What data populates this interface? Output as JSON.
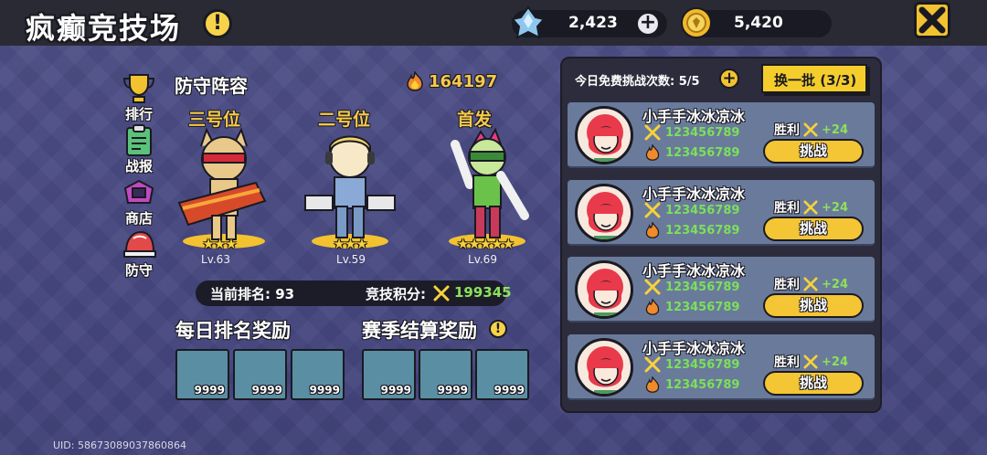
{
  "header": {
    "title": "疯癫竞技场",
    "gems": "2,423",
    "coins": "5,420"
  },
  "nav": [
    {
      "label": "排行",
      "icon": "trophy-icon"
    },
    {
      "label": "战报",
      "icon": "clipboard-icon"
    },
    {
      "label": "商店",
      "icon": "shop-icon"
    },
    {
      "label": "防守",
      "icon": "helmet-icon"
    }
  ],
  "defense": {
    "title": "防守阵容",
    "power": "164197",
    "slots": [
      {
        "position": "三号位",
        "stars": "★★★",
        "level": "Lv.63"
      },
      {
        "position": "二号位",
        "stars": "★★★",
        "level": "Lv.59"
      },
      {
        "position": "首发",
        "stars": "★★★★★",
        "level": "Lv.69"
      }
    ],
    "rank_text": "当前排名: 93",
    "score_label": "竞技积分:",
    "score": "199345"
  },
  "rewards": {
    "daily_title": "每日排名奖励",
    "season_title": "赛季结算奖励",
    "daily": [
      "9999",
      "9999",
      "9999"
    ],
    "season": [
      "9999",
      "9999",
      "9999"
    ]
  },
  "challenge": {
    "free_text": "今日免费挑战次数: 5/5",
    "refresh_label": "换一批 (3/3)",
    "opponents": [
      {
        "name": "小手手冰冰凉冰",
        "attack": "123456789",
        "power": "123456789",
        "win_label": "胜利",
        "win_points": "+24",
        "button": "挑战"
      },
      {
        "name": "小手手冰冰凉冰",
        "attack": "123456789",
        "power": "123456789",
        "win_label": "胜利",
        "win_points": "+24",
        "button": "挑战"
      },
      {
        "name": "小手手冰冰凉冰",
        "attack": "123456789",
        "power": "123456789",
        "win_label": "胜利",
        "win_points": "+24",
        "button": "挑战"
      },
      {
        "name": "小手手冰冰凉冰",
        "attack": "123456789",
        "power": "123456789",
        "win_label": "胜利",
        "win_points": "+24",
        "button": "挑战"
      }
    ]
  },
  "uid": "UID: 58673089037860864",
  "colors": {
    "accent_gold": "#f7c94a",
    "green": "#8de15a",
    "panel": "#2c2c3c",
    "card": "#6a7a9b"
  }
}
